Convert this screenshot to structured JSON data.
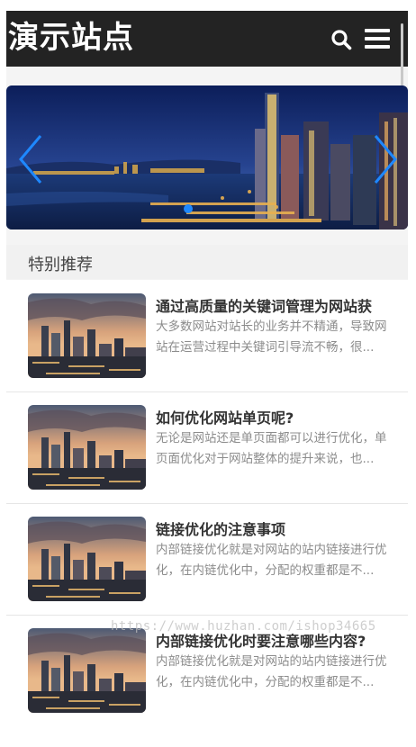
{
  "header": {
    "logo_text": "演示站点",
    "search_icon": "search-icon",
    "menu_icon": "hamburger-menu-icon",
    "background_color": "#232323"
  },
  "banner": {
    "slide_count": 1,
    "active_slide": 1,
    "prev_icon": "chevron-left-icon",
    "next_icon": "chevron-right-icon",
    "accent_color": "#1e88ff"
  },
  "section": {
    "title": "特别推荐"
  },
  "articles": [
    {
      "title": "通过高质量的关键词管理为网站获",
      "desc": "大多数网站对站长的业务并不精通，导致网站在运营过程中关键词引导流不畅，很..."
    },
    {
      "title": "如何优化网站单页呢?",
      "desc": "无论是网站还是单页面都可以进行优化，单页面优化对于网站整体的提升来说，也..."
    },
    {
      "title": "链接优化的注意事项",
      "desc": "内部链接优化就是对网站的站内链接进行优化，在内链优化中，分配的权重都是不..."
    },
    {
      "title": "内部链接优化时要注意哪些内容?",
      "desc": "内部链接优化就是对网站的站内链接进行优化，在内链优化中，分配的权重都是不..."
    }
  ],
  "watermark": "https://www.huzhan.com/ishop34665"
}
